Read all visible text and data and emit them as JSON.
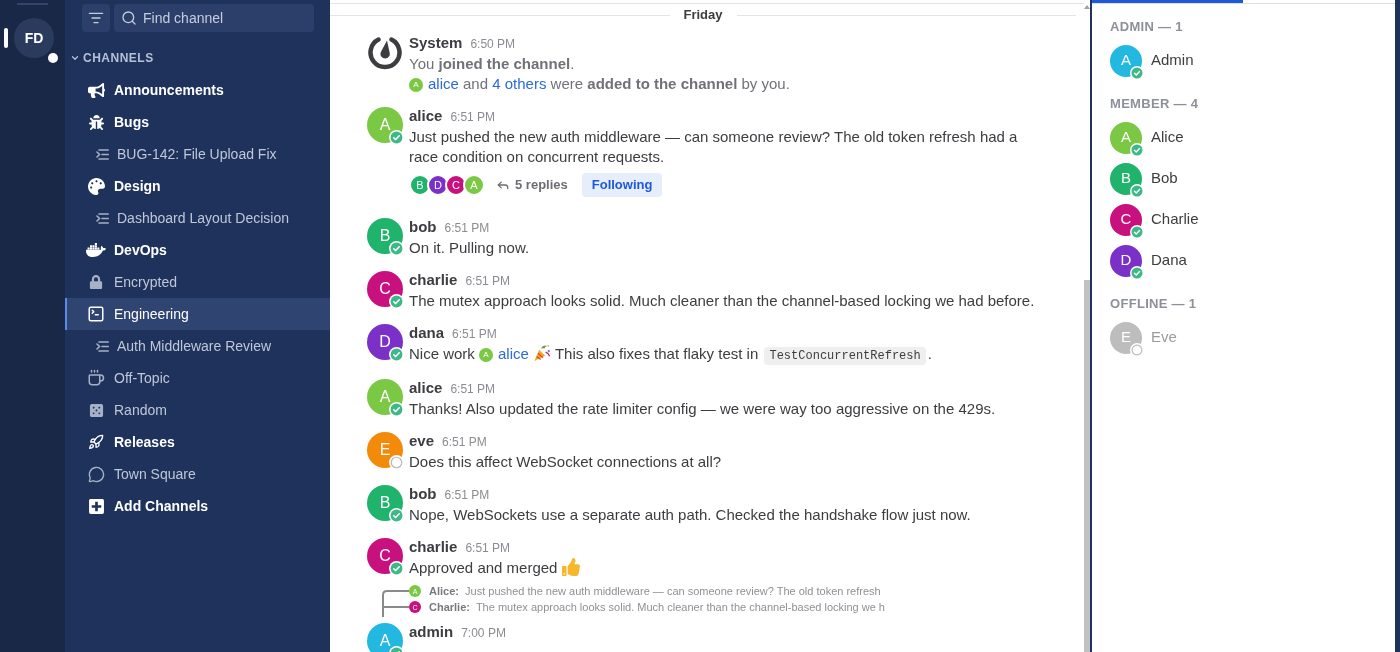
{
  "team_sidebar": {
    "teams": [
      {
        "initials": "FD",
        "selected": true,
        "unread": true
      }
    ]
  },
  "channel_sidebar": {
    "search": {
      "placeholder": "Find channel"
    },
    "section": {
      "title": "CHANNELS",
      "expanded": true
    },
    "items": [
      {
        "kind": "channel",
        "label": "Announcements",
        "unread": true,
        "selected": false
      },
      {
        "kind": "channel",
        "label": "Bugs",
        "unread": true,
        "selected": false
      },
      {
        "kind": "thread",
        "label": "BUG-142: File Upload Fix",
        "unread": false,
        "selected": false
      },
      {
        "kind": "channel",
        "label": "Design",
        "unread": true,
        "selected": false
      },
      {
        "kind": "thread",
        "label": "Dashboard Layout Decision",
        "unread": false,
        "selected": false
      },
      {
        "kind": "channel",
        "label": "DevOps",
        "unread": true,
        "selected": false
      },
      {
        "kind": "channel",
        "label": "Encrypted",
        "unread": false,
        "selected": false
      },
      {
        "kind": "channel",
        "label": "Engineering",
        "unread": false,
        "selected": true
      },
      {
        "kind": "thread",
        "label": "Auth Middleware Review",
        "unread": false,
        "selected": false
      },
      {
        "kind": "channel",
        "label": "Off-Topic",
        "unread": false,
        "selected": false
      },
      {
        "kind": "channel",
        "label": "Random",
        "unread": false,
        "selected": false
      },
      {
        "kind": "channel",
        "label": "Releases",
        "unread": true,
        "selected": false
      },
      {
        "kind": "channel",
        "label": "Town Square",
        "unread": false,
        "selected": false
      },
      {
        "kind": "action",
        "label": "Add Channels",
        "unread": true,
        "selected": false
      }
    ]
  },
  "channel_view": {
    "date_separator": "Friday",
    "messages": [
      {
        "kind": "system",
        "author": "System",
        "time": "6:50 PM",
        "paragraphs": [
          [
            {
              "kind": "text",
              "text": "You **joined the channel**."
            }
          ],
          [
            {
              "kind": "mention",
              "initial": "A",
              "color": "#7ac843",
              "text": "alice"
            },
            {
              "kind": "text",
              "text": " and "
            },
            {
              "kind": "link",
              "text": "4 others"
            },
            {
              "kind": "text",
              "text": " were **added to the channel** by you."
            }
          ]
        ]
      },
      {
        "kind": "user",
        "author": "alice",
        "initial": "A",
        "color": "#7ac843",
        "online": true,
        "time": "6:51 PM",
        "paragraphs": [
          [
            {
              "kind": "text",
              "text": "Just pushed the new auth middleware — can someone review? The old token refresh had a race condition on concurrent requests."
            }
          ]
        ],
        "thread": {
          "participants": [
            {
              "initial": "B",
              "color": "#1fb36c"
            },
            {
              "initial": "D",
              "color": "#7b30c7"
            },
            {
              "initial": "C",
              "color": "#c8107e"
            },
            {
              "initial": "A",
              "color": "#7ac843"
            }
          ],
          "replies": "5 replies",
          "follow_button": "Following"
        }
      },
      {
        "kind": "user",
        "author": "bob",
        "initial": "B",
        "color": "#1fb36c",
        "online": true,
        "time": "6:51 PM",
        "paragraphs": [
          [
            {
              "kind": "text",
              "text": "On it. Pulling now."
            }
          ]
        ]
      },
      {
        "kind": "user",
        "author": "charlie",
        "initial": "C",
        "color": "#c8107e",
        "online": true,
        "time": "6:51 PM",
        "paragraphs": [
          [
            {
              "kind": "text",
              "text": "The mutex approach looks solid. Much cleaner than the channel-based locking we had before."
            }
          ]
        ]
      },
      {
        "kind": "user",
        "author": "dana",
        "initial": "D",
        "color": "#7b30c7",
        "online": true,
        "time": "6:51 PM",
        "paragraphs": [
          [
            {
              "kind": "text",
              "text": "Nice work "
            },
            {
              "kind": "mention",
              "initial": "A",
              "color": "#7ac843",
              "text": "alice"
            },
            {
              "kind": "popper"
            },
            {
              "kind": "text",
              "text": "This also fixes that flaky test in "
            },
            {
              "kind": "code",
              "text": "TestConcurrentRefresh"
            },
            {
              "kind": "text",
              "text": "."
            }
          ]
        ]
      },
      {
        "kind": "user",
        "author": "alice",
        "initial": "A",
        "color": "#7ac843",
        "online": true,
        "time": "6:51 PM",
        "paragraphs": [
          [
            {
              "kind": "text",
              "text": "Thanks! Also updated the rate limiter config — we were way too aggressive on the 429s."
            }
          ]
        ]
      },
      {
        "kind": "user",
        "author": "eve",
        "initial": "E",
        "color": "#f38a0a",
        "online": false,
        "time": "6:51 PM",
        "paragraphs": [
          [
            {
              "kind": "text",
              "text": "Does this affect WebSocket connections at all?"
            }
          ]
        ]
      },
      {
        "kind": "user",
        "author": "bob",
        "initial": "B",
        "color": "#1fb36c",
        "online": true,
        "time": "6:51 PM",
        "paragraphs": [
          [
            {
              "kind": "text",
              "text": "Nope, WebSockets use a separate auth path. Checked the handshake flow just now."
            }
          ]
        ]
      },
      {
        "kind": "user",
        "author": "charlie",
        "initial": "C",
        "color": "#c8107e",
        "online": true,
        "time": "6:51 PM",
        "paragraphs": [
          [
            {
              "kind": "text",
              "text": "Approved and merged"
            },
            {
              "kind": "thumbsup"
            }
          ]
        ]
      },
      {
        "kind": "user",
        "author": "admin",
        "initial": "A",
        "color": "#22b8e0",
        "online": true,
        "time": "7:00 PM",
        "reply_context": [
          {
            "author": "Alice:",
            "initial": "A",
            "color": "#7ac843",
            "text": "Just pushed the new auth middleware — can someone review? The old token refresh"
          },
          {
            "author": "Charlie:",
            "initial": "C",
            "color": "#c8107e",
            "text": "The mutex approach looks solid. Much cleaner than the channel-based locking we h"
          }
        ]
      }
    ]
  },
  "member_panel": {
    "groups": [
      {
        "title": "ADMIN — 1",
        "members": [
          {
            "name": "Admin",
            "initial": "A",
            "color": "#22b8e0",
            "online": true
          }
        ]
      },
      {
        "title": "MEMBER — 4",
        "members": [
          {
            "name": "Alice",
            "initial": "A",
            "color": "#7ac843",
            "online": true
          },
          {
            "name": "Bob",
            "initial": "B",
            "color": "#1fb36c",
            "online": true
          },
          {
            "name": "Charlie",
            "initial": "C",
            "color": "#c8107e",
            "online": true
          },
          {
            "name": "Dana",
            "initial": "D",
            "color": "#7b30c7",
            "online": true
          }
        ]
      },
      {
        "title": "OFFLINE — 1",
        "members": [
          {
            "name": "Eve",
            "initial": "E",
            "color": "#bdbdbd",
            "online": false
          }
        ]
      }
    ]
  }
}
